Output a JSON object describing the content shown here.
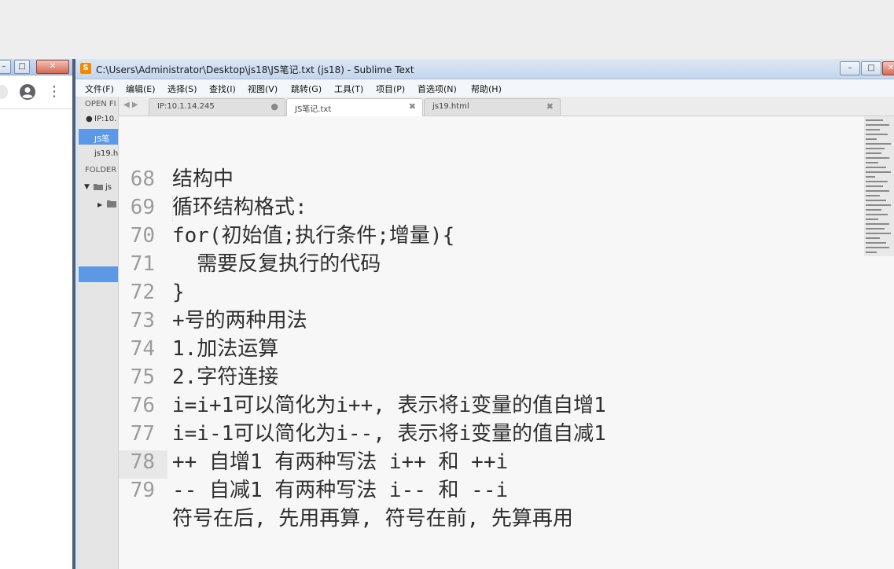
{
  "left_window": {
    "minimize_label": "–",
    "maximize_label": "□",
    "close_label": "✕"
  },
  "sublime": {
    "title": "C:\\Users\\Administrator\\Desktop\\js18\\JS笔记.txt (js18) - Sublime Text",
    "app_icon_letter": "S",
    "menu": [
      "文件(F)",
      "编辑(E)",
      "选择(S)",
      "查找(I)",
      "视图(V)",
      "跳转(G)",
      "工具(T)",
      "项目(P)",
      "首选项(N)",
      "帮助(H)"
    ],
    "sidebar": {
      "open_files_label": "OPEN FI",
      "open_files": [
        "IP:10.",
        "JS笔",
        "js19.h"
      ],
      "folders_label": "FOLDER",
      "folder_root": "js",
      "folder_child": ""
    },
    "tabs": [
      {
        "label": "IP:10.1.14.245",
        "close": "●",
        "active": false
      },
      {
        "label": "JS笔记.txt",
        "close": "✖",
        "active": true
      },
      {
        "label": "js19.html",
        "close": "✖",
        "active": false
      }
    ],
    "tab_nav": "◀ ▶",
    "lines": [
      {
        "n": "",
        "text": "结构中"
      },
      {
        "n": "68",
        "text": "循环结构格式:"
      },
      {
        "n": "69",
        "text": "for(初始值;执行条件;增量){"
      },
      {
        "n": "70",
        "text": "  需要反复执行的代码"
      },
      {
        "n": "71",
        "text": "}"
      },
      {
        "n": "72",
        "text": "+号的两种用法"
      },
      {
        "n": "73",
        "text": "1.加法运算"
      },
      {
        "n": "74",
        "text": "2.字符连接"
      },
      {
        "n": "75",
        "text": "i=i+1可以简化为i++, 表示将i变量的值自增1"
      },
      {
        "n": "76",
        "text": "i=i-1可以简化为i--, 表示将i变量的值自减1"
      },
      {
        "n": "77",
        "text": "++ 自增1 有两种写法 i++ 和 ++i"
      },
      {
        "n": "78",
        "text": "-- 自减1 有两种写法 i-- 和 --i"
      },
      {
        "n": "79",
        "text": "符号在后, 先用再算, 符号在前, 先算再用"
      }
    ],
    "current_line": "79"
  },
  "colors": {
    "selection_blue": "#5d98e6",
    "app_icon_orange": "#f08a00",
    "line_number_gray": "#9c9c9c",
    "code_text": "#2f2f2f"
  }
}
